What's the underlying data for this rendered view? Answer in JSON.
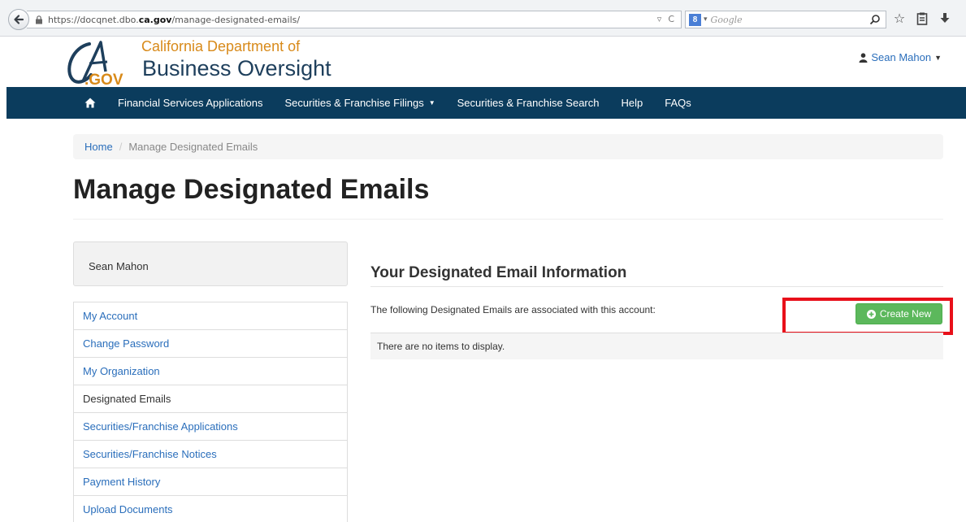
{
  "browser": {
    "url_prefix": "https://docqnet.dbo.",
    "url_domain": "ca.gov",
    "url_path": "/manage-designated-emails/",
    "search_placeholder": "Google",
    "search_engine_badge": "8"
  },
  "header": {
    "dept_line1": "California Department of",
    "dept_line2": "Business Oversight",
    "user_name": "Sean Mahon"
  },
  "nav": {
    "items": [
      {
        "label": "Financial Services Applications"
      },
      {
        "label": "Securities & Franchise Filings",
        "dropdown": true
      },
      {
        "label": "Securities & Franchise Search"
      },
      {
        "label": "Help"
      },
      {
        "label": "FAQs"
      }
    ]
  },
  "breadcrumb": {
    "home": "Home",
    "separator": "/",
    "current": "Manage Designated Emails"
  },
  "page": {
    "title": "Manage Designated Emails"
  },
  "sidebar": {
    "user_name": "Sean Mahon",
    "items": [
      {
        "label": "My Account"
      },
      {
        "label": "Change Password"
      },
      {
        "label": "My Organization"
      },
      {
        "label": "Designated Emails",
        "active": true
      },
      {
        "label": "Securities/Franchise Applications"
      },
      {
        "label": "Securities/Franchise Notices"
      },
      {
        "label": "Payment History"
      },
      {
        "label": "Upload Documents"
      }
    ]
  },
  "main": {
    "section_title": "Your Designated Email Information",
    "assoc_text": "The following Designated Emails are associated with this account:",
    "create_button": "Create New",
    "empty_text": "There are no items to display."
  },
  "colors": {
    "nav_bg": "#0b3c5d",
    "link": "#2a6ebb",
    "button_green": "#5cb85c",
    "highlight_red": "#e8101a",
    "dept_orange": "#d88a1a"
  }
}
